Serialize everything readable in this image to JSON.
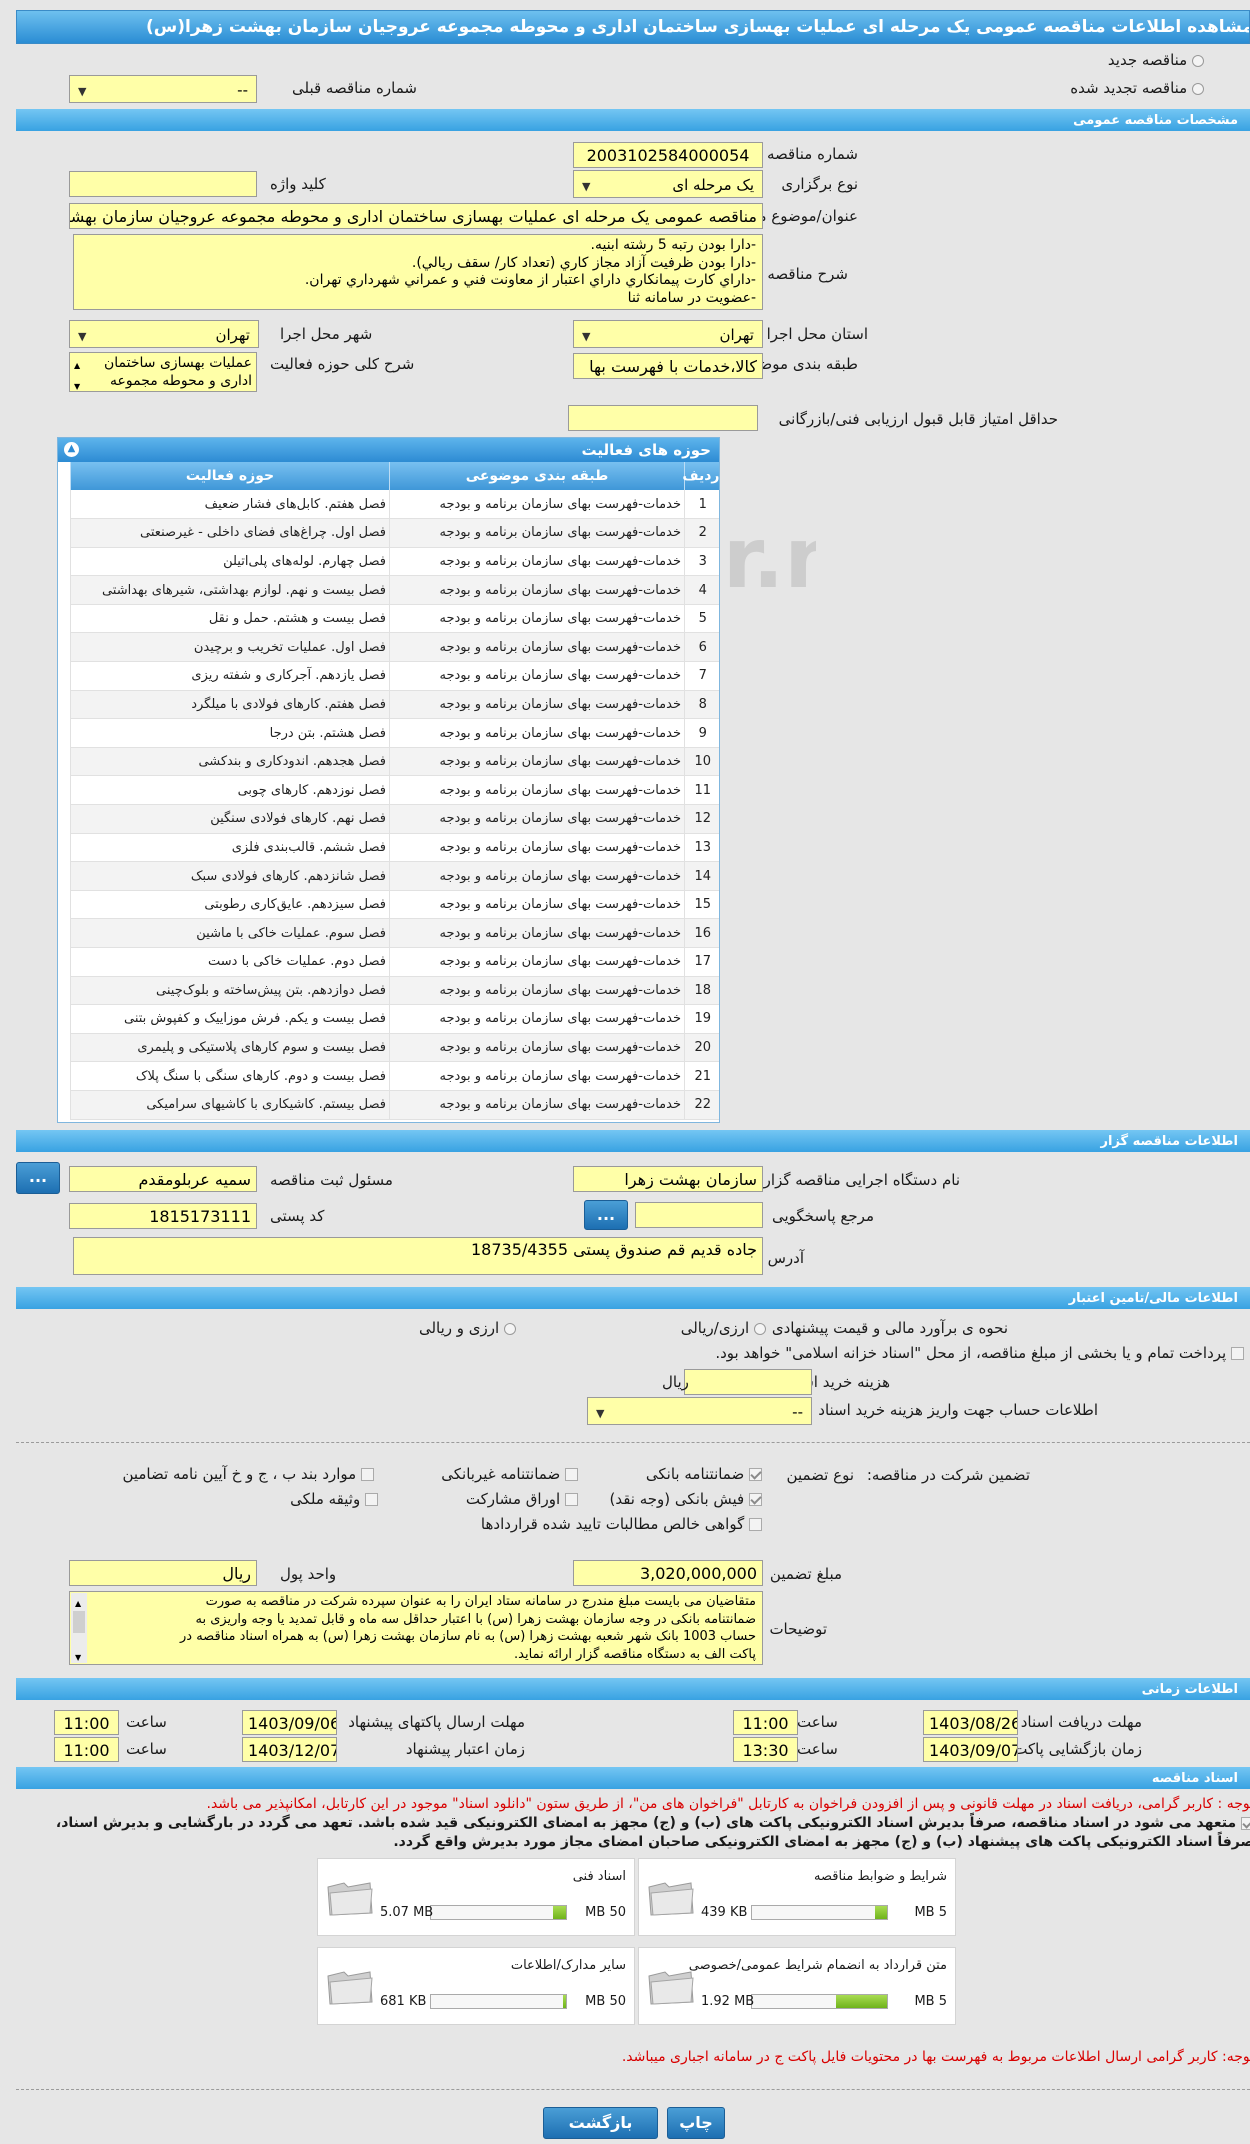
{
  "header": {
    "title": "مشاهده اطلاعات مناقصه عمومی یک مرحله ای عملیات بهسازی ساختمان اداری و محوطه مجموعه عروجیان سازمان بهشت زهرا(س)"
  },
  "tender_type": {
    "new_label": "مناقصه جدید",
    "renewed_label": "مناقصه تجدید شده",
    "prev_number_label": "شماره مناقصه قبلی",
    "prev_number_value": "--"
  },
  "general": {
    "section_title": "مشخصات مناقصه عمومی",
    "number_label": "شماره مناقصه",
    "number_value": "2003102584000054",
    "holding_type_label": "نوع برگزاری",
    "holding_type_value": "یک مرحله ای",
    "keyword_label": "کلید واژه",
    "keyword_value": "",
    "subject_label": "عنوان/موضوع مناقصه",
    "subject_value": "مناقصه عمومی یک مرحله ای عملیات بهسازی ساختمان اداری و محوطه مجموعه عروجیان سازمان بهشت زهرا(س)",
    "desc_label": "شرح مناقصه",
    "desc_lines": [
      "-دارا بودن رتبه 5 رشته ابنيه.",
      "-دارا بودن ظرفيت آزاد مجاز كاري (تعداد كار/ سقف ريالي).",
      "-داراي كارت پيمانكاري داراي اعتبار از معاونت فني و عمراني شهرداري تهران.",
      "-عضويت در سامانه ثنا"
    ],
    "province_label": "استان محل اجرا",
    "province_value": "تهران",
    "city_label": "شهر محل اجرا",
    "city_value": "تهران",
    "category_label": "طبقه بندی موضوعی",
    "category_value": "کالا،خدمات با فهرست بها",
    "scope_label": "شرح کلی حوزه فعالیت",
    "scope_lines": [
      "عملیات بهسازی ساختمان",
      "اداری و محوطه مجموعه"
    ],
    "min_score_label": "حداقل امتیاز قابل قبول ارزیابی فنی/بازرگانی",
    "min_score_value": ""
  },
  "activity": {
    "panel_title": "حوزه های فعالیت",
    "columns": [
      "ردیف",
      "طبقه بندی موضوعی",
      "حوزه فعالیت"
    ],
    "rows": [
      [
        "1",
        "خدمات-فهرست بهای سازمان برنامه و بودجه",
        "فصل هفتم. کابل‌های فشار ضعیف"
      ],
      [
        "2",
        "خدمات-فهرست بهای سازمان برنامه و بودجه",
        "فصل اول. چراغ‌های فضای داخلی - غیرصنعتی"
      ],
      [
        "3",
        "خدمات-فهرست بهای سازمان برنامه و بودجه",
        "فصل چهارم. لوله‌های پلی‌اتیلن"
      ],
      [
        "4",
        "خدمات-فهرست بهای سازمان برنامه و بودجه",
        "فصل بیست و نهم. لوازم بهداشتی، شیرهای بهداشتی"
      ],
      [
        "5",
        "خدمات-فهرست بهای سازمان برنامه و بودجه",
        "فصل بیست و هشتم. حمل و نقل"
      ],
      [
        "6",
        "خدمات-فهرست بهای سازمان برنامه و بودجه",
        "فصل اول. عملیات تخریب و برچیدن"
      ],
      [
        "7",
        "خدمات-فهرست بهای سازمان برنامه و بودجه",
        "فصل یازدهم. آجرکاری و شفته ریزی"
      ],
      [
        "8",
        "خدمات-فهرست بهای سازمان برنامه و بودجه",
        "فصل هفتم. کارهای فولادی با میلگرد"
      ],
      [
        "9",
        "خدمات-فهرست بهای سازمان برنامه و بودجه",
        "فصل هشتم. بتن درجا"
      ],
      [
        "10",
        "خدمات-فهرست بهای سازمان برنامه و بودجه",
        "فصل هجدهم. اندودکاری و بندکشی"
      ],
      [
        "11",
        "خدمات-فهرست بهای سازمان برنامه و بودجه",
        "فصل نوزدهم. کارهای چوبی"
      ],
      [
        "12",
        "خدمات-فهرست بهای سازمان برنامه و بودجه",
        "فصل نهم. کارهای فولادی سنگین"
      ],
      [
        "13",
        "خدمات-فهرست بهای سازمان برنامه و بودجه",
        "فصل ششم. قالب‌بندی فلزی"
      ],
      [
        "14",
        "خدمات-فهرست بهای سازمان برنامه و بودجه",
        "فصل شانزدهم. کارهای فولادی سبک"
      ],
      [
        "15",
        "خدمات-فهرست بهای سازمان برنامه و بودجه",
        "فصل سیزدهم. عایق‌کاری رطوبتی"
      ],
      [
        "16",
        "خدمات-فهرست بهای سازمان برنامه و بودجه",
        "فصل سوم. عملیات خاکی با ماشین"
      ],
      [
        "17",
        "خدمات-فهرست بهای سازمان برنامه و بودجه",
        "فصل دوم. عملیات خاکی با دست"
      ],
      [
        "18",
        "خدمات-فهرست بهای سازمان برنامه و بودجه",
        "فصل دوازدهم. بتن پیش‌ساخته و بلوک‌چینی"
      ],
      [
        "19",
        "خدمات-فهرست بهای سازمان برنامه و بودجه",
        "فصل بیست و یکم. فرش موزاییک و کفپوش بتنی"
      ],
      [
        "20",
        "خدمات-فهرست بهای سازمان برنامه و بودجه",
        "فصل بیست و سوم کارهای پلاستیکی و پلیمری"
      ],
      [
        "21",
        "خدمات-فهرست بهای سازمان برنامه و بودجه",
        "فصل بیست و دوم. کارهای سنگی با سنگ پلاک"
      ],
      [
        "22",
        "خدمات-فهرست بهای سازمان برنامه و بودجه",
        "فصل بیستم. کاشیکاری با کاشیهای سرامیکی"
      ]
    ]
  },
  "organizer": {
    "section_title": "اطلاعات مناقصه گزار",
    "org_label": "نام دستگاه اجرایی مناقصه گزار",
    "org_value": "سازمان بهشت زهرا",
    "resp_label": "مسئول ثبت مناقصه",
    "resp_value": "سمیه عربلومقدم",
    "ref_label": "مرجع پاسخگویی",
    "ref_value": "",
    "postal_label": "کد پستی",
    "postal_value": "1815173111",
    "address_label": "آدرس",
    "address_value": "جاده قدیم قم صندوق پستی 18735/4355",
    "more_button": "..."
  },
  "finance": {
    "section_title": "اطلاعات مالی/تامین اعتبار",
    "estimate_label": "نحوه ی برآورد مالی و قیمت پیشنهادی",
    "opt_rial": "ارزی/ریالی",
    "opt_fx_rial": "ارزی و ریالی",
    "treasury_note": "پرداخت تمام و یا بخشی از مبلغ مناقصه، از محل \"اسناد خزانه اسلامی\" خواهد بود.",
    "doc_fee_label": "هزینه خرید اسناد",
    "doc_fee_unit": "ریال",
    "doc_fee_value": "",
    "account_label": "اطلاعات حساب جهت واریز هزینه خرید اسناد",
    "account_value": "--"
  },
  "guarantee": {
    "main_label": "تضمین شرکت در مناقصه:",
    "type_label": "نوع تضمین",
    "opts": {
      "bank": "ضمانتنامه بانکی",
      "nonbank": "ضمانتنامه غیربانکی",
      "clause": "موارد بند ب ، ج و خ آیین نامه تضامین",
      "check": "فیش بانکی (وجه نقد)",
      "bonds": "اوراق مشارکت",
      "property": "وثیقه ملکی",
      "claims": "گواهی خالص مطالبات تایید شده قراردادها"
    },
    "amount_label": "مبلغ تضمین",
    "amount_value": "3,020,000,000",
    "currency_label": "واحد پول",
    "currency_value": "ریال",
    "notes_label": "توضیحات",
    "notes_lines": [
      "متقاضیان می بایست مبلغ مندرج در سامانه ستاد ایران را به عنوان سپرده شرکت در مناقصه به صورت",
      "ضمانتنامه بانکی در وجه سازمان بهشت زهرا (س) با اعتبار حداقل سه ماه و قابل تمدید یا وجه واریزی به",
      "حساب 1003 بانک شهر شعبه بهشت زهرا (س) به نام سازمان بهشت زهرا (س) به همراه اسناد مناقصه در",
      "پاکت الف به دستگاه مناقصه گزار ارائه نماید."
    ]
  },
  "timing": {
    "section_title": "اطلاعات زمانی",
    "receive_label": "مهلت دریافت اسناد",
    "receive_date": "1403/08/26",
    "receive_time": "11:00",
    "send_label": "مهلت ارسال پاکتهای پیشنهاد",
    "send_date": "1403/09/06",
    "send_time": "11:00",
    "open_label": "زمان بازگشایی پاکت ها",
    "open_date": "1403/09/07",
    "open_time": "13:30",
    "valid_label": "زمان اعتبار پیشنهاد",
    "valid_date": "1403/12/07",
    "valid_time": "11:00",
    "time_label": "ساعت"
  },
  "documents": {
    "section_title": "اسناد مناقصه",
    "note1": "توجه : کاربر گرامی، دریافت اسناد در مهلت قانونی و پس از افزودن فراخوان به کارتابل \"فراخوان های من\"، از طریق ستون \"دانلود اسناد\" موجود در این کارتابل، امکانپذیر می باشد.",
    "commit_line1": "متعهد می شود در اسناد مناقصه، صرفاً بدیرش اسناد الکترونیکی پاکت های (ب) و (ج) مجهز به امضای الکترونیکی قید شده باشد. تعهد می گردد در بارگشایی و بدیرش اسناد،",
    "commit_line2": "صرفاً اسناد الکترونیکی پاکت های پیشنهاد (ب) و (ج) مجهز به امضای الکترونیکی صاحبان امضای مجاز مورد بدیرش واقع گردد.",
    "files": [
      {
        "name": "شرایط و ضوابط مناقصه",
        "size": "439 KB",
        "max": "5 MB",
        "fill": 0.09
      },
      {
        "name": "اسناد فنی",
        "size": "5.07 MB",
        "max": "50 MB",
        "fill": 0.1
      },
      {
        "name": "متن قرارداد به انضمام شرایط عمومی/خصوصی",
        "size": "1.92 MB",
        "max": "5 MB",
        "fill": 0.38
      },
      {
        "name": "سایر مدارک/اطلاعات",
        "size": "681 KB",
        "max": "50 MB",
        "fill": 0.02
      }
    ],
    "note2": "توجه: کاربر گرامی ارسال اطلاعات مربوط به فهرست بها در محتویات فایل پاکت ج در سامانه اجباری میباشد."
  },
  "footer": {
    "back_button": "بازگشت",
    "print_button": "چاپ"
  },
  "colors": {
    "accent": "#2d8bd3",
    "field": "#ffffa8",
    "warning": "#d80000"
  }
}
